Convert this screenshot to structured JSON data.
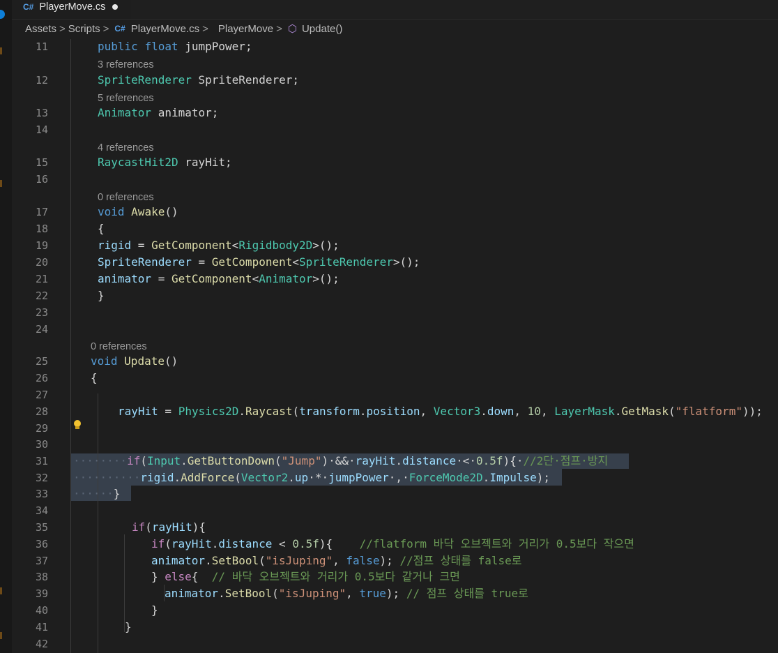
{
  "tab": {
    "title": "PlayerMove.cs",
    "lang_badge": "C#",
    "dirty": true
  },
  "breadcrumb": {
    "items": [
      "Assets",
      "Scripts",
      "PlayerMove.cs",
      "PlayerMove",
      "Update()"
    ],
    "separator": ">"
  },
  "editor": {
    "lines": [
      {
        "num": "11",
        "segments": [
          [
            "kw",
            "public"
          ],
          [
            "",
            " "
          ],
          [
            "kw",
            "float"
          ],
          [
            "",
            " jumpPower;"
          ]
        ]
      },
      {
        "num": "12",
        "segments": [
          [
            "ty",
            "SpriteRenderer"
          ],
          [
            "",
            " SpriteRenderer;"
          ]
        ]
      },
      {
        "num": "13",
        "segments": [
          [
            "ty",
            "Animator"
          ],
          [
            "",
            " animator;"
          ]
        ]
      },
      {
        "num": "14",
        "segments": []
      },
      {
        "num": "15",
        "segments": [
          [
            "ty",
            "RaycastHit2D"
          ],
          [
            "",
            " rayHit;"
          ]
        ]
      },
      {
        "num": "16",
        "segments": []
      },
      {
        "num": "17",
        "segments": [
          [
            "kw",
            "void"
          ],
          [
            "",
            " "
          ],
          [
            "fn",
            "Awake"
          ],
          [
            "",
            "()"
          ]
        ]
      },
      {
        "num": "18",
        "segments": [
          [
            "",
            "{"
          ]
        ]
      },
      {
        "num": "19",
        "segments": [
          [
            "va",
            "rigid"
          ],
          [
            "",
            " = "
          ],
          [
            "fn",
            "GetComponent"
          ],
          [
            "",
            "<"
          ],
          [
            "ty",
            "Rigidbody2D"
          ],
          [
            "",
            ">();"
          ]
        ]
      },
      {
        "num": "20",
        "segments": [
          [
            "va",
            "SpriteRenderer"
          ],
          [
            "",
            " = "
          ],
          [
            "fn",
            "GetComponent"
          ],
          [
            "",
            "<"
          ],
          [
            "ty",
            "SpriteRenderer"
          ],
          [
            "",
            ">();"
          ]
        ]
      },
      {
        "num": "21",
        "segments": [
          [
            "va",
            "animator"
          ],
          [
            "",
            " = "
          ],
          [
            "fn",
            "GetComponent"
          ],
          [
            "",
            "<"
          ],
          [
            "ty",
            "Animator"
          ],
          [
            "",
            ">();"
          ]
        ]
      },
      {
        "num": "22",
        "segments": [
          [
            "",
            "}"
          ]
        ]
      },
      {
        "num": "23",
        "segments": []
      },
      {
        "num": "24",
        "segments": []
      },
      {
        "num": "25",
        "segments": [
          [
            "kw",
            "void"
          ],
          [
            "",
            " "
          ],
          [
            "fn",
            "Update"
          ],
          [
            "",
            "()"
          ]
        ]
      },
      {
        "num": "26",
        "segments": [
          [
            "",
            "{"
          ]
        ]
      },
      {
        "num": "27",
        "segments": []
      },
      {
        "num": "28",
        "segments": [
          [
            "va",
            "rayHit"
          ],
          [
            "",
            " = "
          ],
          [
            "ty",
            "Physics2D"
          ],
          [
            "",
            "."
          ],
          [
            "fn",
            "Raycast"
          ],
          [
            "",
            "("
          ],
          [
            "va",
            "transform"
          ],
          [
            "",
            "."
          ],
          [
            "va",
            "position"
          ],
          [
            "",
            ", "
          ],
          [
            "ty",
            "Vector3"
          ],
          [
            "",
            "."
          ],
          [
            "va",
            "down"
          ],
          [
            "",
            ", "
          ],
          [
            "nu",
            "10"
          ],
          [
            "",
            ", "
          ],
          [
            "ty",
            "LayerMask"
          ],
          [
            "",
            "."
          ],
          [
            "fn",
            "GetMask"
          ],
          [
            "",
            "("
          ],
          [
            "st",
            "\"flatform\""
          ],
          [
            "",
            "));"
          ]
        ]
      },
      {
        "num": "29",
        "segments": []
      },
      {
        "num": "30",
        "segments": []
      },
      {
        "num": "31",
        "segments": [
          [
            "ctl",
            "if"
          ],
          [
            "",
            "("
          ],
          [
            "ty",
            "Input"
          ],
          [
            "",
            "."
          ],
          [
            "fn",
            "GetButtonDown"
          ],
          [
            "",
            "("
          ],
          [
            "st",
            "\"Jump\""
          ],
          [
            "",
            ")·&&·"
          ],
          [
            "va",
            "rayHit"
          ],
          [
            "",
            "."
          ],
          [
            "va",
            "distance"
          ],
          [
            "",
            "·<·"
          ],
          [
            "nu",
            "0.5f"
          ],
          [
            "",
            "){·"
          ],
          [
            "cm",
            "//2단·점프·방지"
          ]
        ]
      },
      {
        "num": "32",
        "segments": [
          [
            "va",
            "rigid"
          ],
          [
            "",
            "."
          ],
          [
            "fn",
            "AddForce"
          ],
          [
            "",
            "("
          ],
          [
            "ty",
            "Vector2"
          ],
          [
            "",
            "."
          ],
          [
            "va",
            "up"
          ],
          [
            "",
            "·*·"
          ],
          [
            "va",
            "jumpPower"
          ],
          [
            "",
            "·,·"
          ],
          [
            "ty",
            "ForceMode2D"
          ],
          [
            "",
            "."
          ],
          [
            "va",
            "Impulse"
          ],
          [
            "",
            ");"
          ]
        ]
      },
      {
        "num": "33",
        "segments": [
          [
            "",
            "}"
          ]
        ]
      },
      {
        "num": "34",
        "segments": []
      },
      {
        "num": "35",
        "segments": [
          [
            "ctl",
            "if"
          ],
          [
            "",
            "("
          ],
          [
            "va",
            "rayHit"
          ],
          [
            "",
            "){"
          ]
        ]
      },
      {
        "num": "36",
        "segments": [
          [
            "ctl",
            "if"
          ],
          [
            "",
            "("
          ],
          [
            "va",
            "rayHit"
          ],
          [
            "",
            "."
          ],
          [
            "va",
            "distance"
          ],
          [
            "",
            " < "
          ],
          [
            "nu",
            "0.5f"
          ],
          [
            "",
            "){    "
          ],
          [
            "cm",
            "//flatform 바닥 오브젝트와 거리가 0.5보다 작으면"
          ]
        ]
      },
      {
        "num": "37",
        "segments": [
          [
            "va",
            "animator"
          ],
          [
            "",
            "."
          ],
          [
            "fn",
            "SetBool"
          ],
          [
            "",
            "("
          ],
          [
            "st",
            "\"isJuping\""
          ],
          [
            "",
            ", "
          ],
          [
            "kw",
            "false"
          ],
          [
            "",
            "); "
          ],
          [
            "cm",
            "//점프 상태를 false로"
          ]
        ]
      },
      {
        "num": "38",
        "segments": [
          [
            "",
            "} "
          ],
          [
            "ctl",
            "else"
          ],
          [
            "",
            "{  "
          ],
          [
            "cm",
            "// 바닥 오브젝트와 거리가 0.5보다 같거나 크면"
          ]
        ]
      },
      {
        "num": "39",
        "segments": [
          [
            "va",
            "animator"
          ],
          [
            "",
            "."
          ],
          [
            "fn",
            "SetBool"
          ],
          [
            "",
            "("
          ],
          [
            "st",
            "\"isJuping\""
          ],
          [
            "",
            ", "
          ],
          [
            "kw",
            "true"
          ],
          [
            "",
            "); "
          ],
          [
            "cm",
            "// 점프 상태를 true로"
          ]
        ]
      },
      {
        "num": "40",
        "segments": [
          [
            "",
            "}"
          ]
        ]
      },
      {
        "num": "41",
        "segments": [
          [
            "",
            "}"
          ]
        ]
      },
      {
        "num": "42",
        "segments": []
      }
    ],
    "code_lens": [
      {
        "before": "12",
        "text": "3 references"
      },
      {
        "before": "13",
        "text": "5 references"
      },
      {
        "before": "15",
        "text": "4 references"
      },
      {
        "before": "17",
        "text": "0 references"
      },
      {
        "before": "25",
        "text": "0 references"
      }
    ]
  },
  "colors": {
    "background": "#1e1e1e",
    "keyword": "#569cd6",
    "type": "#4ec9b0",
    "function": "#dcdcaa",
    "variable": "#9cdcfe",
    "string": "#ce9178",
    "number": "#b5cea8",
    "comment": "#6a9955",
    "control": "#c586c0",
    "selection": "#37404c"
  },
  "icons": [
    "csharp-file-icon",
    "class-icon",
    "method-icon",
    "lightbulb-icon"
  ]
}
